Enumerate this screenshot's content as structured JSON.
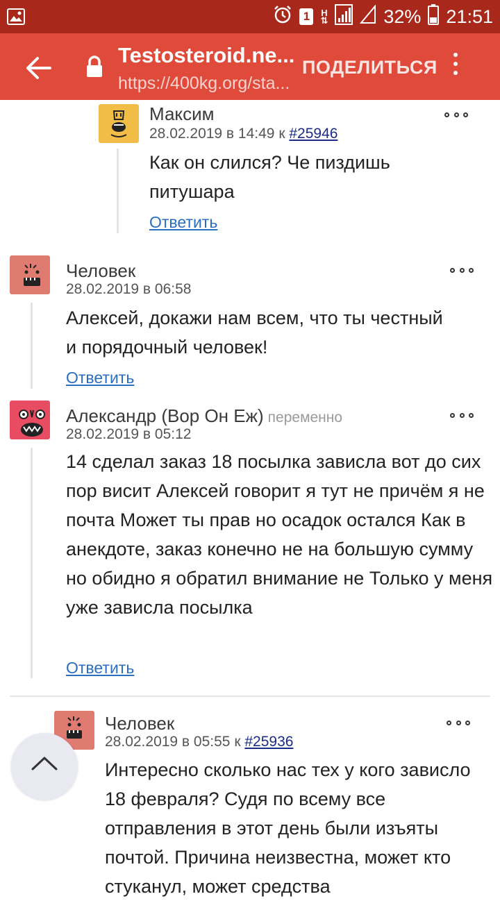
{
  "status_bar": {
    "battery_percent": "32%",
    "time": "21:51",
    "sim_label": "1",
    "network": "H"
  },
  "app_bar": {
    "title": "Testosteroid.ne...",
    "url": "https://400kg.org/sta...",
    "share_label": "ПОДЕЛИТЬСЯ"
  },
  "comments": [
    {
      "author": "Максим",
      "date": "28.02.2019 в 14:49 к",
      "ref": "#25946",
      "text": "Как он слился? Че пиздишь питушара",
      "reply": "Ответить"
    },
    {
      "author": "Человек",
      "date": "28.02.2019 в 06:58",
      "text": "Алексей, докажи нам всем, что ты честный и порядочный человек!",
      "reply": "Ответить"
    },
    {
      "author": "Александр (Вор Он Еж)",
      "extra": "переменно",
      "date": "28.02.2019 в 05:12",
      "text": "14 сделал заказ 18 посылка зависла вот до сих пор висит Алексей говорит я тут не причём я не почта Может ты прав но осадок остался Как в анекдоте, заказ конечно не на большую сумму но обидно я обратил внимание не Только у меня уже зависла посылка",
      "reply": "Ответить"
    },
    {
      "author": "Человек",
      "date": "28.02.2019 в 05:55 к",
      "ref": "#25936",
      "text": "Интересно сколько нас тех у кого зависло 18 февраля? Судя по всему все отправления в этот день были изъяты почтой. Причина неизвестна, может кто стуканул, может средства"
    }
  ],
  "colors": {
    "status_bar": "#a8281b",
    "app_bar": "#e04a3a",
    "link": "#2a6ec2",
    "ref_link": "#1a2b88"
  }
}
